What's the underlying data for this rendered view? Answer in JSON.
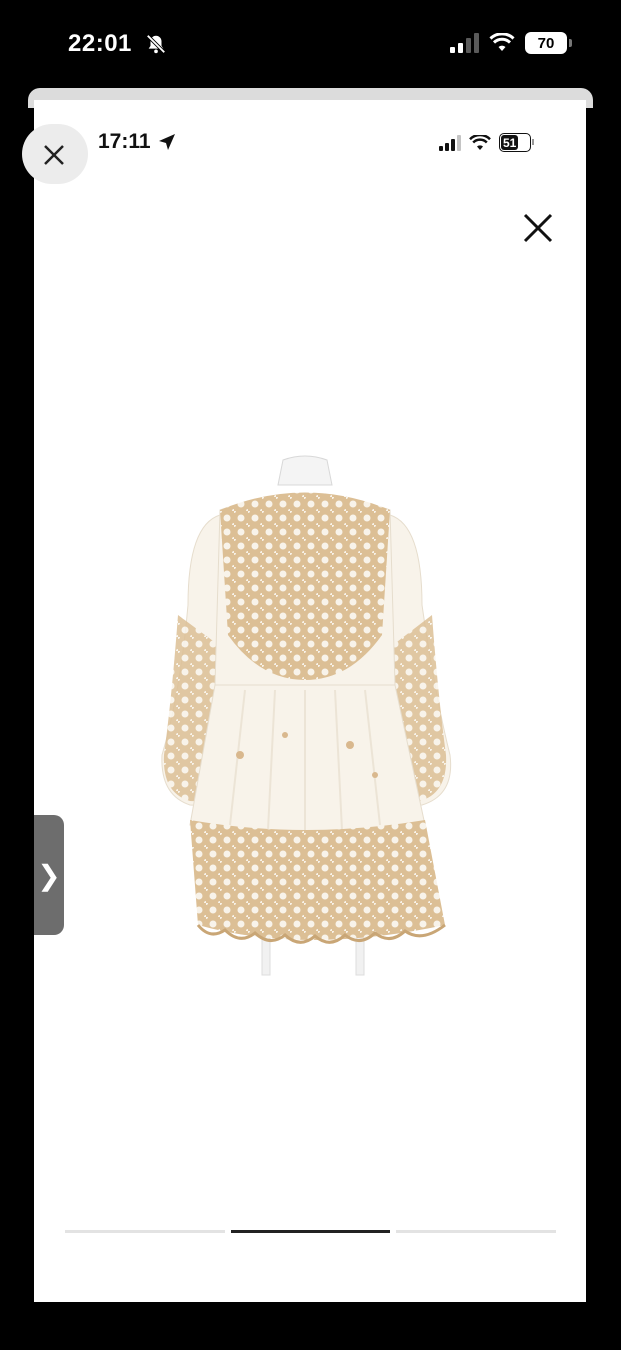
{
  "outer_status": {
    "time": "22:01",
    "battery": "70",
    "icons": [
      "bell-slash-icon",
      "signal-icon",
      "wifi-icon",
      "battery-icon"
    ]
  },
  "inner_status": {
    "time": "17:11",
    "battery": "51",
    "icons": [
      "location-arrow-icon",
      "signal-icon",
      "wifi-icon",
      "battery-icon"
    ]
  },
  "controls": {
    "close_icon": "close-icon",
    "side_tab_glyph": "❯"
  },
  "product": {
    "image_icon": "dress-photo",
    "colors": {
      "fabric": "#f8f3ea",
      "lace": "#d9b88e",
      "lace_dark": "#b9935f"
    }
  },
  "pager": {
    "total": 3,
    "active_index": 1
  }
}
